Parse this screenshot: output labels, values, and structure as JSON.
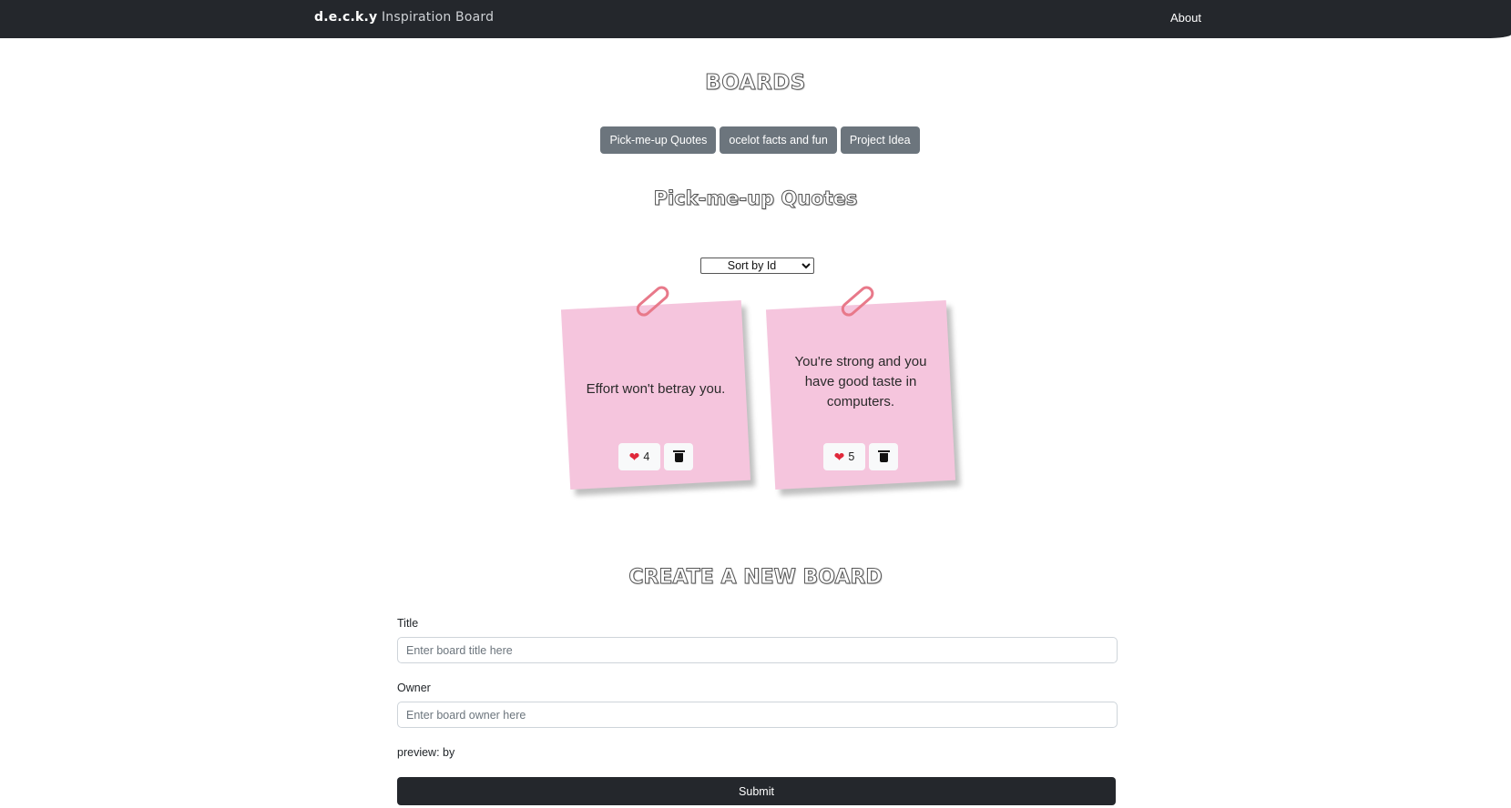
{
  "navbar": {
    "brand_bold": "d.e.c.k.y",
    "brand_rest": " Inspiration Board",
    "about": "About"
  },
  "boards": {
    "heading": "BOARDS",
    "items": [
      {
        "label": "Pick-me-up Quotes"
      },
      {
        "label": "ocelot facts and fun"
      },
      {
        "label": "Project Idea"
      }
    ]
  },
  "selected_board": {
    "title": "Pick-me-up Quotes",
    "sort": {
      "selected": "Sort by Id"
    },
    "cards": [
      {
        "message": "Effort won't betray you.",
        "likes": "4",
        "like_icon": "heart-icon",
        "delete_icon": "trash-icon"
      },
      {
        "message": "You're strong and you have good taste in computers.",
        "likes": "5",
        "like_icon": "heart-icon",
        "delete_icon": "trash-icon"
      }
    ]
  },
  "create_form": {
    "heading": "CREATE A NEW BOARD",
    "title_label": "Title",
    "title_placeholder": "Enter board title here",
    "title_value": "",
    "owner_label": "Owner",
    "owner_placeholder": "Enter board owner here",
    "owner_value": "",
    "preview": "preview: by",
    "submit": "Submit"
  },
  "colors": {
    "navbar": "#24272c",
    "board_button": "#6c757d",
    "sticky_note": "#f5c5dd",
    "paperclip": "#e8798a",
    "heart": "#e0283b",
    "submit": "#24272c"
  }
}
